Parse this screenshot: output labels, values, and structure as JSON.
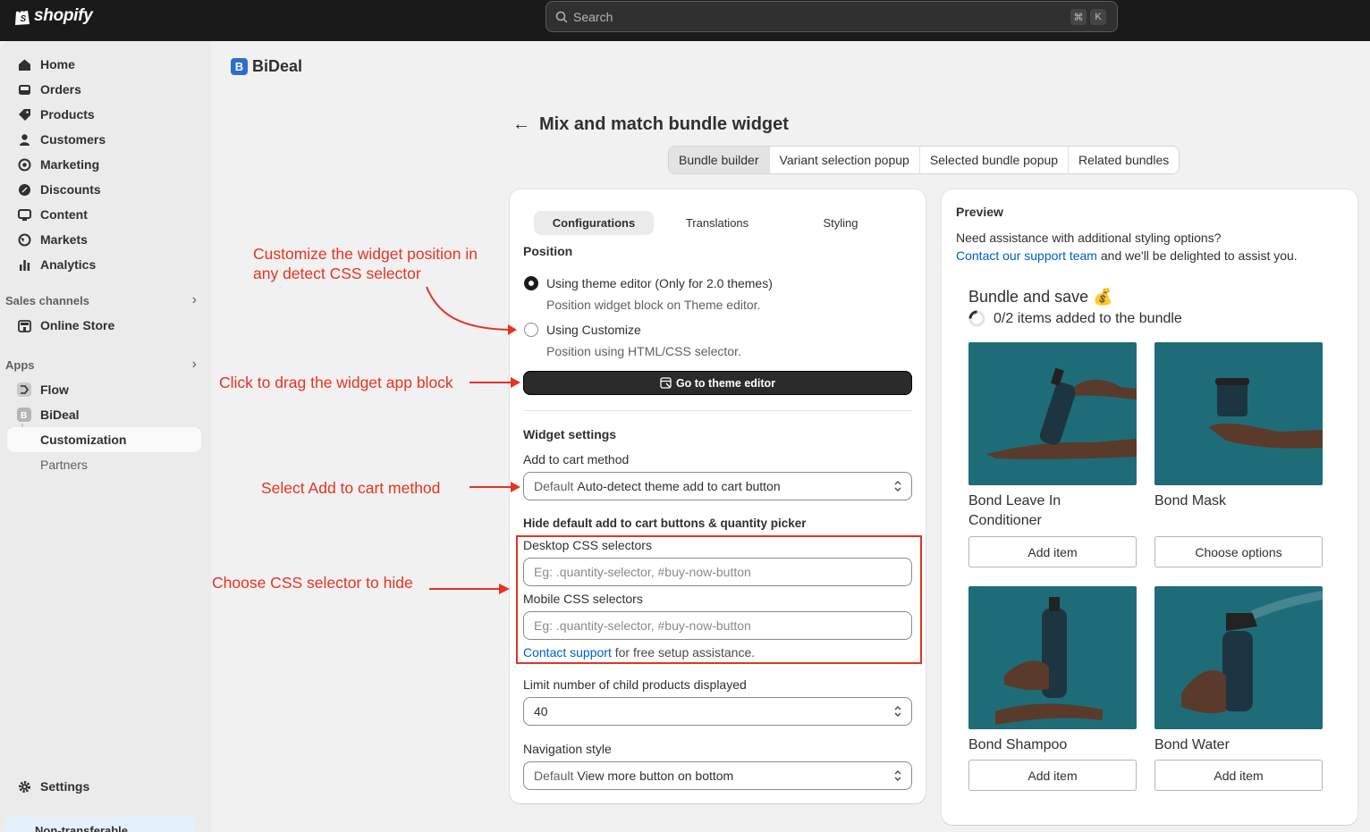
{
  "topbar": {
    "logo": "shopify",
    "search_placeholder": "Search",
    "shortcut_keys": [
      "⌘",
      "K"
    ]
  },
  "sidebar": {
    "items": [
      {
        "label": "Home",
        "icon": "home-icon"
      },
      {
        "label": "Orders",
        "icon": "orders-icon"
      },
      {
        "label": "Products",
        "icon": "tag-icon"
      },
      {
        "label": "Customers",
        "icon": "person-icon"
      },
      {
        "label": "Marketing",
        "icon": "target-icon"
      },
      {
        "label": "Discounts",
        "icon": "discount-icon"
      },
      {
        "label": "Content",
        "icon": "content-icon"
      },
      {
        "label": "Markets",
        "icon": "globe-icon"
      },
      {
        "label": "Analytics",
        "icon": "chart-icon"
      }
    ],
    "sales_channels_heading": "Sales channels",
    "online_store": "Online Store",
    "apps_heading": "Apps",
    "flow": "Flow",
    "bideal": "BiDeal",
    "customization": "Customization",
    "partners": "Partners",
    "settings": "Settings",
    "bottom_note": "Non-transferable"
  },
  "app": {
    "name": "BiDeal",
    "page_title": "Mix and match bundle widget",
    "tabs": [
      "Bundle builder",
      "Variant selection popup",
      "Selected bundle popup",
      "Related bundles"
    ],
    "active_tab": "Bundle builder"
  },
  "config": {
    "segments": [
      "Configurations",
      "Translations",
      "Styling"
    ],
    "active_segment": "Configurations",
    "position_heading": "Position",
    "option1_label": "Using theme editor (Only for 2.0 themes)",
    "option1_help": "Position widget block on Theme editor.",
    "option2_label": "Using Customize",
    "option2_help": "Position using HTML/CSS selector.",
    "selected_option": "Using theme editor (Only for 2.0 themes)",
    "theme_editor_button": "Go to theme editor",
    "widget_settings_heading": "Widget settings",
    "add_to_cart_label": "Add to cart method",
    "add_to_cart_prefix": "Default",
    "add_to_cart_value": "Auto-detect theme add to cart button",
    "hide_heading": "Hide default add to cart buttons & quantity picker",
    "desktop_label": "Desktop CSS selectors",
    "desktop_placeholder": "Eg: .quantity-selector, #buy-now-button",
    "mobile_label": "Mobile CSS selectors",
    "mobile_placeholder": "Eg: .quantity-selector, #buy-now-button",
    "contact_link": "Contact support",
    "contact_rest": "for free setup assistance.",
    "limit_label": "Limit number of child products displayed",
    "limit_value": "40",
    "nav_style_label": "Navigation style",
    "nav_style_prefix": "Default",
    "nav_style_value": "View more button on bottom"
  },
  "annotations": {
    "a1_line1": "Customize the widget position in",
    "a1_line2": "any detect CSS selector",
    "a2": "Click to drag the widget app block",
    "a3": "Select Add to cart method",
    "a4": "Choose CSS selector to hide",
    "color": "#e63322"
  },
  "preview": {
    "title": "Preview",
    "help_text": "Need assistance with additional styling options?",
    "link": "Contact our support team",
    "link_rest": "and we'll be delighted to assist you.",
    "bundle_title": "Bundle and save 💰",
    "progress": "0/2 items added to the bundle",
    "products": [
      {
        "name": "Bond Leave In Conditioner",
        "button": "Add item"
      },
      {
        "name": "Bond Mask",
        "button": "Choose options"
      },
      {
        "name": "Bond Shampoo",
        "button": "Add item"
      },
      {
        "name": "Bond Water",
        "button": "Add item"
      }
    ],
    "product_bg": "#1f6c79"
  }
}
